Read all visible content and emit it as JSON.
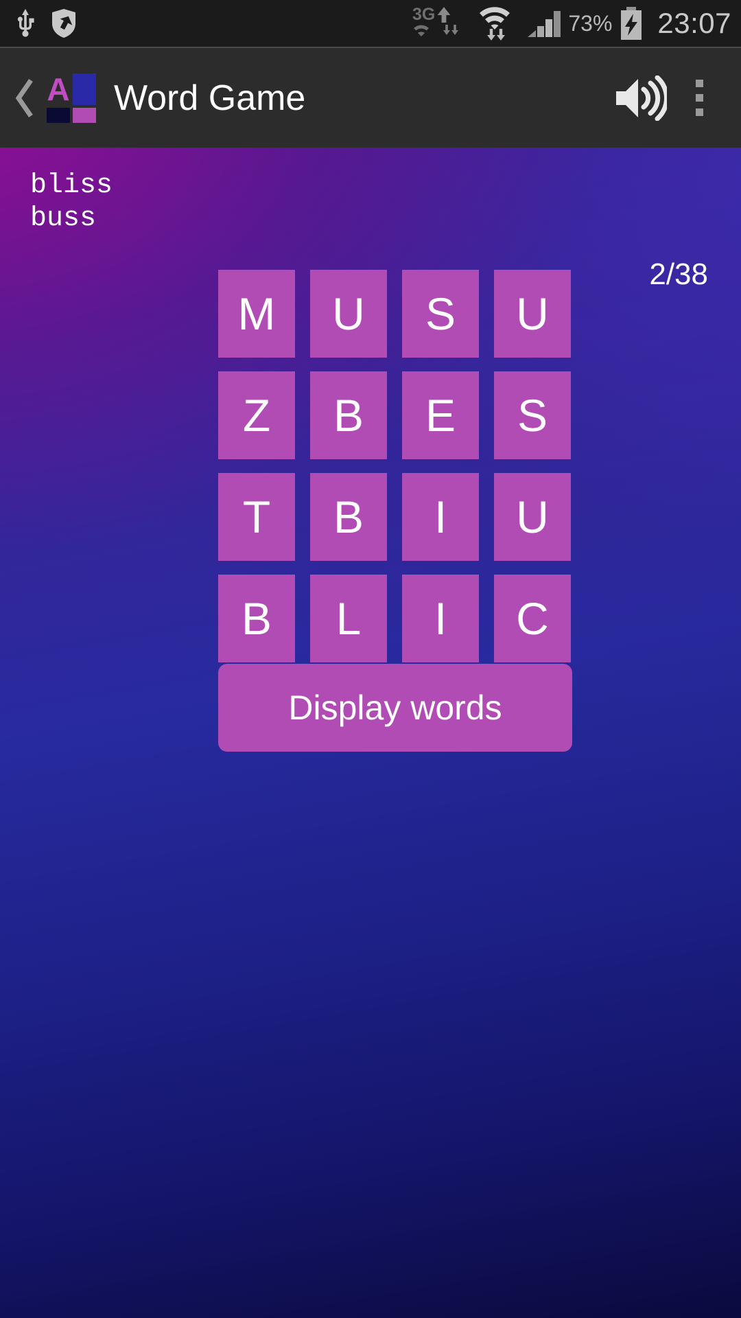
{
  "status_bar": {
    "icons": [
      "usb-icon",
      "shield-sync-icon"
    ],
    "network_type": "3G",
    "network_icons": [
      "3g-data-icon",
      "wifi-icon",
      "cellular-signal-icon"
    ],
    "battery_percent": "73%",
    "battery_icon": "battery-charging-icon",
    "clock": "23:07"
  },
  "app_bar": {
    "back_label": "‹",
    "logo": {
      "letter": "A",
      "letter_color": "#c24cc2",
      "top_right_color": "#2a2aa8",
      "bottom_left_color": "#0a0a35",
      "bottom_right_color": "#b04cb4"
    },
    "title": "Word Game",
    "sound_icon": "volume-on-icon",
    "overflow_icon": "overflow-menu-icon"
  },
  "game": {
    "found_words": [
      "bliss",
      "buss"
    ],
    "counter": "2/38",
    "grid": {
      "rows": 4,
      "cols": 4,
      "letters": [
        [
          "M",
          "U",
          "S",
          "U"
        ],
        [
          "Z",
          "B",
          "E",
          "S"
        ],
        [
          "T",
          "B",
          "I",
          "U"
        ],
        [
          "B",
          "L",
          "I",
          "C"
        ]
      ]
    },
    "display_words_button": "Display words",
    "colors": {
      "tile": "#b04cb4",
      "button": "#b04cb4",
      "text": "#ffffff",
      "bg_top_left": "#8a1090",
      "bg_mid": "#2a2a9a",
      "bg_bottom": "#0a0a3e"
    }
  }
}
